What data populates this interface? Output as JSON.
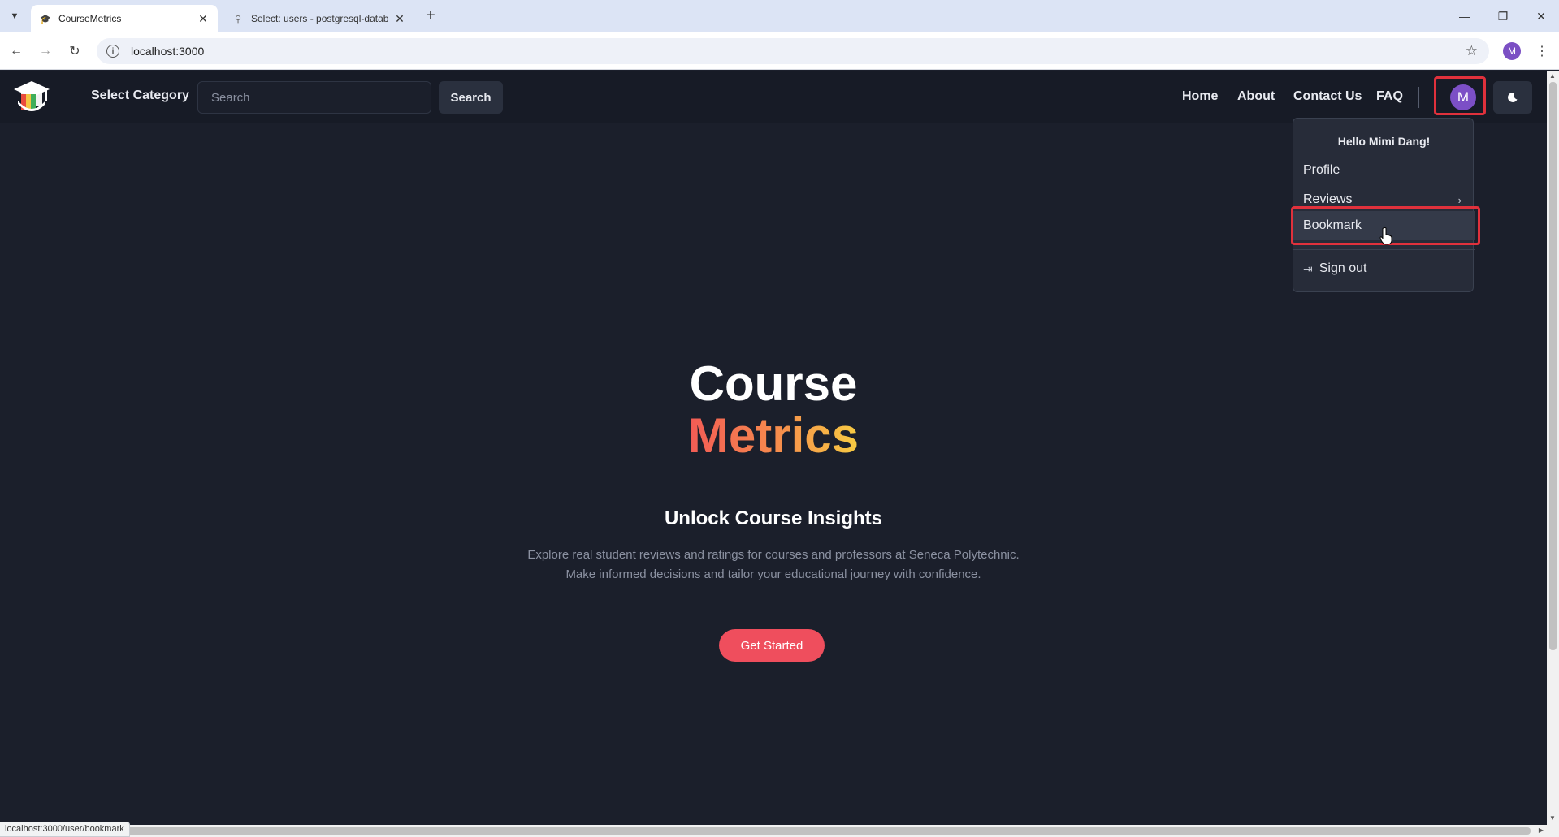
{
  "browser": {
    "tabs": [
      {
        "title": "CourseMetrics",
        "active": true
      },
      {
        "title": "Select: users - postgresql-datab",
        "active": false
      }
    ],
    "url": "localhost:3000",
    "profile_initial": "M",
    "status_url": "localhost:3000/user/bookmark"
  },
  "navbar": {
    "select_category": "Select Category",
    "search_placeholder": "Search",
    "search_button": "Search",
    "links": [
      "Home",
      "About",
      "Contact Us",
      "FAQ"
    ],
    "avatar_initial": "M"
  },
  "dropdown": {
    "greeting": "Hello Mimi Dang!",
    "items": [
      "Profile",
      "Reviews",
      "Bookmark",
      "Sign out"
    ]
  },
  "hero": {
    "title_line1": "Course",
    "title_line2": "Metrics",
    "subtitle": "Unlock Course Insights",
    "desc_line1": "Explore real student reviews and ratings for courses and professors at Seneca Polytechnic.",
    "desc_line2": "Make informed decisions and tailor your educational journey with confidence.",
    "cta": "Get Started"
  },
  "colors": {
    "background": "#1b1f2b",
    "accent": "#ef4e5d",
    "highlight_border": "#e0313c",
    "avatar": "#7c4fc6"
  }
}
